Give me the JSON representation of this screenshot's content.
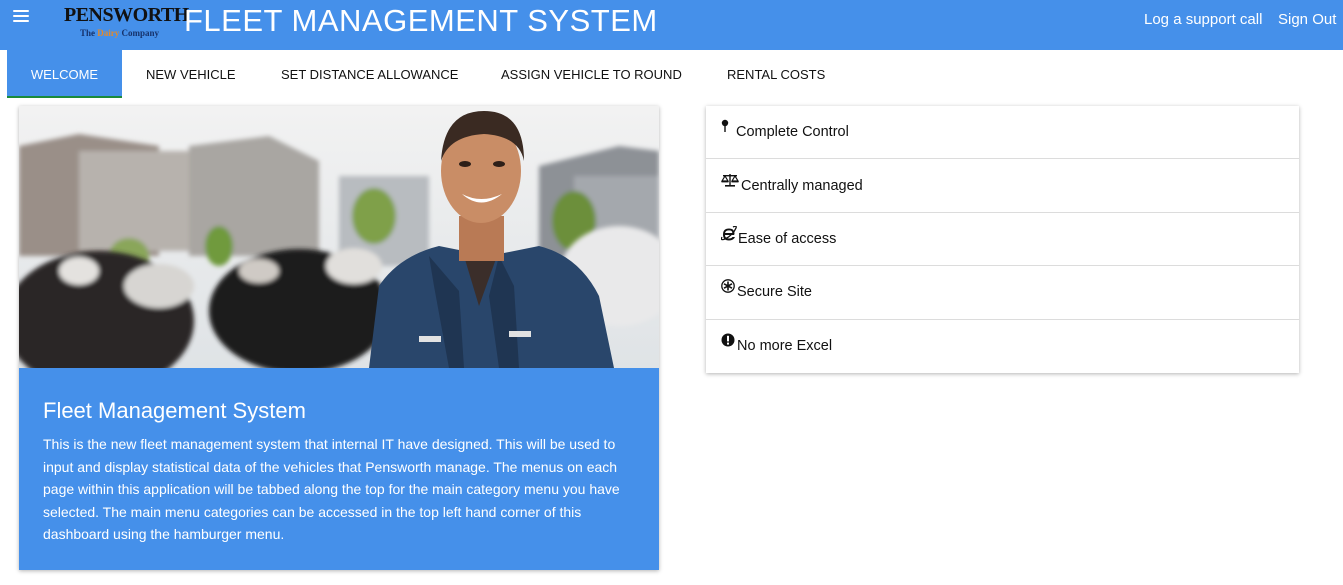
{
  "header": {
    "logo": {
      "main": "PENSWORTH",
      "sub_prefix": "The ",
      "sub_dairy": "Dairy",
      "sub_suffix": " Company"
    },
    "title": "FLEET MANAGEMENT SYSTEM",
    "support_link": "Log a support call",
    "signout_link": "Sign Out",
    "menu_icon": "hamburger-icon",
    "colors": {
      "bar": "#4590ea",
      "text": "#ffffff"
    }
  },
  "tabs": [
    {
      "label": "WELCOME",
      "active": true
    },
    {
      "label": "NEW VEHICLE",
      "active": false
    },
    {
      "label": "SET DISTANCE ALLOWANCE",
      "active": false
    },
    {
      "label": "ASSIGN VEHICLE TO ROUND",
      "active": false
    },
    {
      "label": "RENTAL COSTS",
      "active": false
    }
  ],
  "hero": {
    "title": "Fleet Management System",
    "text": "This is the new fleet management system that internal IT have designed. This will be used to input and display statistical data of the vehicles that Pensworth manage. The menus on each page within this application will be tabbed along the top for the main category menu you have selected. The main menu categories can be accessed in the top left hand corner of this dashboard using the hamburger menu."
  },
  "features": [
    {
      "icon": "pin-icon",
      "label": "Complete Control"
    },
    {
      "icon": "scales-icon",
      "label": "Centrally managed"
    },
    {
      "icon": "ie-icon",
      "label": "Ease of access"
    },
    {
      "icon": "asterisk-icon",
      "label": "Secure Site"
    },
    {
      "icon": "exclamation-icon",
      "label": "No more Excel"
    }
  ],
  "colors": {
    "accent": "#4590ea",
    "active_tab_underline": "#1a8a3c"
  }
}
